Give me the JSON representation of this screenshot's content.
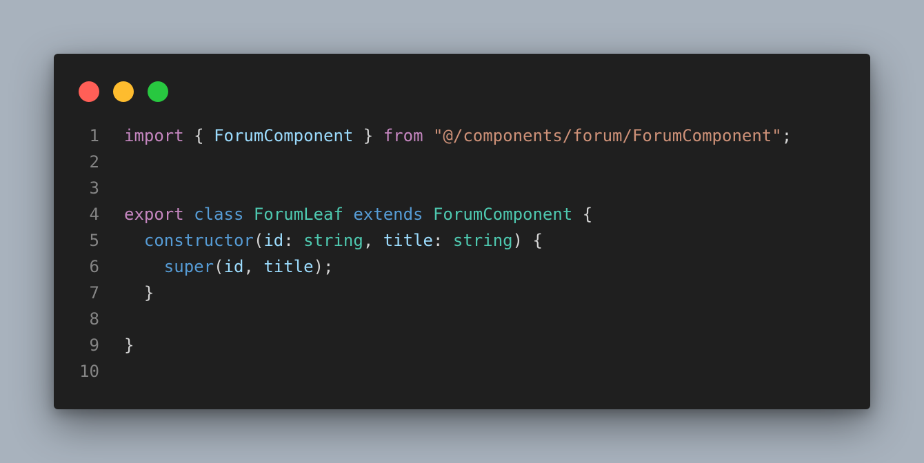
{
  "window": {
    "controls": {
      "close_color": "#ff5f57",
      "minimize_color": "#febc2e",
      "maximize_color": "#28c840"
    }
  },
  "code": {
    "language": "typescript",
    "lines": [
      {
        "number": "1",
        "tokens": [
          {
            "t": "import",
            "c": "kw-ctl"
          },
          {
            "t": " { ",
            "c": "punc"
          },
          {
            "t": "ForumComponent",
            "c": "var"
          },
          {
            "t": " } ",
            "c": "punc"
          },
          {
            "t": "from",
            "c": "kw-ctl"
          },
          {
            "t": " ",
            "c": "punc"
          },
          {
            "t": "\"@/components/forum/ForumComponent\"",
            "c": "str"
          },
          {
            "t": ";",
            "c": "punc"
          }
        ]
      },
      {
        "number": "2",
        "tokens": []
      },
      {
        "number": "3",
        "tokens": []
      },
      {
        "number": "4",
        "tokens": [
          {
            "t": "export",
            "c": "kw-ctl"
          },
          {
            "t": " ",
            "c": "punc"
          },
          {
            "t": "class",
            "c": "kw"
          },
          {
            "t": " ",
            "c": "punc"
          },
          {
            "t": "ForumLeaf",
            "c": "type"
          },
          {
            "t": " ",
            "c": "punc"
          },
          {
            "t": "extends",
            "c": "kw"
          },
          {
            "t": " ",
            "c": "punc"
          },
          {
            "t": "ForumComponent",
            "c": "type"
          },
          {
            "t": " {",
            "c": "punc"
          }
        ]
      },
      {
        "number": "5",
        "tokens": [
          {
            "t": "  ",
            "c": "punc"
          },
          {
            "t": "constructor",
            "c": "kw"
          },
          {
            "t": "(",
            "c": "punc"
          },
          {
            "t": "id",
            "c": "var"
          },
          {
            "t": ": ",
            "c": "punc"
          },
          {
            "t": "string",
            "c": "type"
          },
          {
            "t": ", ",
            "c": "punc"
          },
          {
            "t": "title",
            "c": "var"
          },
          {
            "t": ": ",
            "c": "punc"
          },
          {
            "t": "string",
            "c": "type"
          },
          {
            "t": ") {",
            "c": "punc"
          }
        ]
      },
      {
        "number": "6",
        "tokens": [
          {
            "t": "    ",
            "c": "punc"
          },
          {
            "t": "super",
            "c": "kw"
          },
          {
            "t": "(",
            "c": "punc"
          },
          {
            "t": "id",
            "c": "var"
          },
          {
            "t": ", ",
            "c": "punc"
          },
          {
            "t": "title",
            "c": "var"
          },
          {
            "t": ");",
            "c": "punc"
          }
        ]
      },
      {
        "number": "7",
        "tokens": [
          {
            "t": "  }",
            "c": "punc"
          }
        ]
      },
      {
        "number": "8",
        "tokens": []
      },
      {
        "number": "9",
        "tokens": [
          {
            "t": "}",
            "c": "punc"
          }
        ]
      },
      {
        "number": "10",
        "tokens": []
      }
    ]
  }
}
